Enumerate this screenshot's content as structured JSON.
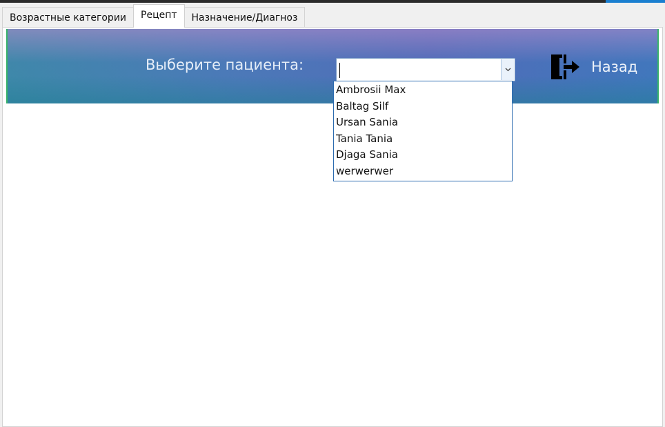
{
  "tabs": [
    {
      "label": "Возрастные категории",
      "active": false
    },
    {
      "label": "Рецепт",
      "active": true
    },
    {
      "label": "Назначение/Диагноз",
      "active": false
    }
  ],
  "header": {
    "prompt_label": "Выберите пациента:",
    "patient_input": {
      "value": "",
      "placeholder": ""
    },
    "back_label": "Назад",
    "back_icon": "exit-door-icon"
  },
  "dropdown": {
    "items": [
      "Ambrosii Max",
      "Baltag Silf",
      "Ursan Sania",
      "Tania Tania",
      "Djaga Sania",
      "werwerwer"
    ]
  },
  "colors": {
    "band_start": "#3c8aa8",
    "band_end": "#3e78bc",
    "band_border": "#39b36a",
    "dropdown_border": "#2c6bb0"
  }
}
